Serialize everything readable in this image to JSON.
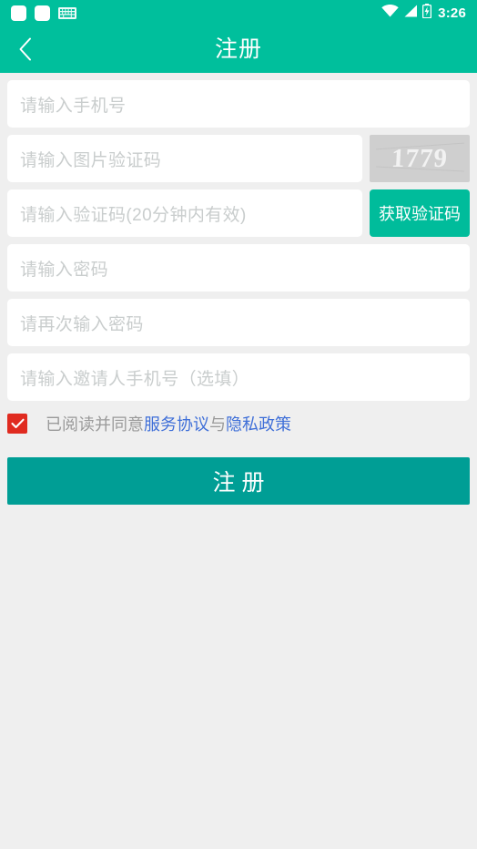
{
  "status_bar": {
    "icons_left": [
      "notification-square",
      "notification-square",
      "keyboard-icon"
    ],
    "icons_right": [
      "wifi-icon",
      "signal-icon",
      "battery-icon"
    ],
    "clock": "3:26",
    "background_color": "#00bf9c"
  },
  "app_bar": {
    "back_icon": "chevron-left-icon",
    "title": "注册",
    "background_color": "#00bf9c"
  },
  "form": {
    "phone": {
      "placeholder": "请输入手机号",
      "value": ""
    },
    "image_captcha": {
      "placeholder": "请输入图片验证码",
      "value": "",
      "captcha_code": "1779"
    },
    "sms_code": {
      "placeholder": "请输入验证码(20分钟内有效)",
      "value": "",
      "send_button_label": "获取验证码",
      "send_button_color": "#00bc9b"
    },
    "password": {
      "placeholder": "请输入密码",
      "value": ""
    },
    "password_confirm": {
      "placeholder": "请再次输入密码",
      "value": ""
    },
    "inviter_phone": {
      "placeholder": "请输入邀请人手机号（选填）",
      "value": ""
    }
  },
  "agreement": {
    "checked": true,
    "checkbox_color": "#e02b20",
    "prefix_text": "已阅读并同意",
    "service_link": "服务协议",
    "conjunction": "与",
    "privacy_link": "隐私政策",
    "link_color": "#3f6fd8"
  },
  "submit": {
    "label": "注册",
    "background_color": "#009e95"
  },
  "colors": {
    "page_background": "#efefef",
    "field_background": "#ffffff",
    "placeholder": "#c9cdcd"
  }
}
